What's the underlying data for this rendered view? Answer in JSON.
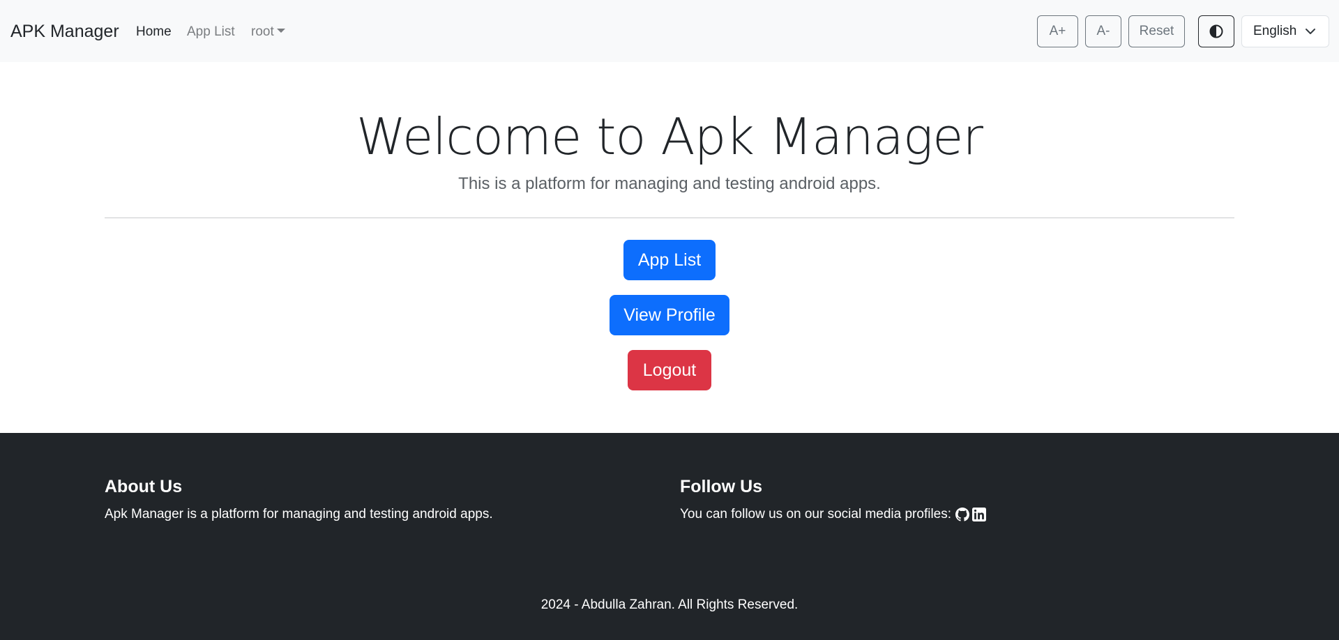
{
  "navbar": {
    "brand": "APK Manager",
    "links": {
      "home": "Home",
      "app_list": "App List",
      "user": "root"
    },
    "buttons": {
      "font_increase": "A+",
      "font_decrease": "A-",
      "reset": "Reset",
      "contrast_icon": "contrast-icon"
    },
    "language": {
      "selected": "English"
    }
  },
  "main": {
    "title": "Welcome to Apk Manager",
    "subtitle": "This is a platform for managing and testing android apps.",
    "buttons": {
      "app_list": "App List",
      "view_profile": "View Profile",
      "logout": "Logout"
    }
  },
  "footer": {
    "about_title": "About Us",
    "about_text": "Apk Manager is a platform for managing and testing android apps.",
    "follow_title": "Follow Us",
    "follow_text": "You can follow us on our social media profiles:",
    "social_icons": [
      "github-icon",
      "linkedin-icon"
    ],
    "copyright": "2024 - Abdulla Zahran. All Rights Reserved."
  },
  "colors": {
    "primary": "#0d6efd",
    "danger": "#dc3545",
    "footer_bg": "#212529",
    "navbar_bg": "#f8f9fa"
  }
}
